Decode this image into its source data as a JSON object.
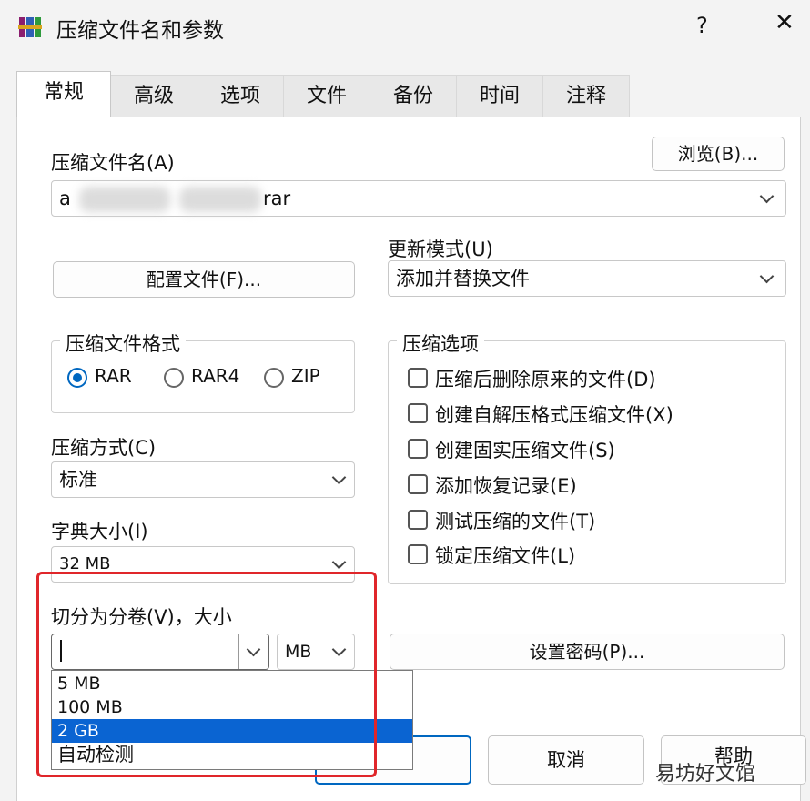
{
  "window": {
    "title": "压缩文件名和参数",
    "help_label": "?",
    "close_label": "✕"
  },
  "tabs": [
    {
      "label": "常规"
    },
    {
      "label": "高级"
    },
    {
      "label": "选项"
    },
    {
      "label": "文件"
    },
    {
      "label": "备份"
    },
    {
      "label": "时间"
    },
    {
      "label": "注释"
    }
  ],
  "general": {
    "archive_name_label": "压缩文件名(A)",
    "browse_label": "浏览(B)...",
    "archive_name_value_start": "a",
    "archive_name_value_end": "rar",
    "update_mode_label": "更新模式(U)",
    "update_mode_value": "添加并替换文件",
    "profiles_label": "配置文件(F)...",
    "format_group_label": "压缩文件格式",
    "formats": [
      {
        "label": "RAR",
        "selected": true
      },
      {
        "label": "RAR4",
        "selected": false
      },
      {
        "label": "ZIP",
        "selected": false
      }
    ],
    "options_group_label": "压缩选项",
    "options": [
      {
        "label": "压缩后删除原来的文件(D)",
        "checked": false
      },
      {
        "label": "创建自解压格式压缩文件(X)",
        "checked": false
      },
      {
        "label": "创建固实压缩文件(S)",
        "checked": false
      },
      {
        "label": "添加恢复记录(E)",
        "checked": false
      },
      {
        "label": "测试压缩的文件(T)",
        "checked": false
      },
      {
        "label": "锁定压缩文件(L)",
        "checked": false
      }
    ],
    "method_label": "压缩方式(C)",
    "method_value": "标准",
    "dict_label": "字典大小(I)",
    "dict_value": "32 MB",
    "split_label": "切分为分卷(V)，大小",
    "split_value": "",
    "split_unit": "MB",
    "split_options": [
      {
        "label": "5 MB",
        "selected": false
      },
      {
        "label": "100 MB",
        "selected": false
      },
      {
        "label": "2 GB",
        "selected": true
      },
      {
        "label": "自动检测",
        "selected": false
      }
    ],
    "password_label": "设置密码(P)...",
    "cancel_label": "取消",
    "help_button_label": "帮助"
  },
  "watermark": "易坊好文馆",
  "colors": {
    "accent": "#0067c0",
    "selection": "#0a64d2",
    "highlight_box": "#e0262a"
  }
}
